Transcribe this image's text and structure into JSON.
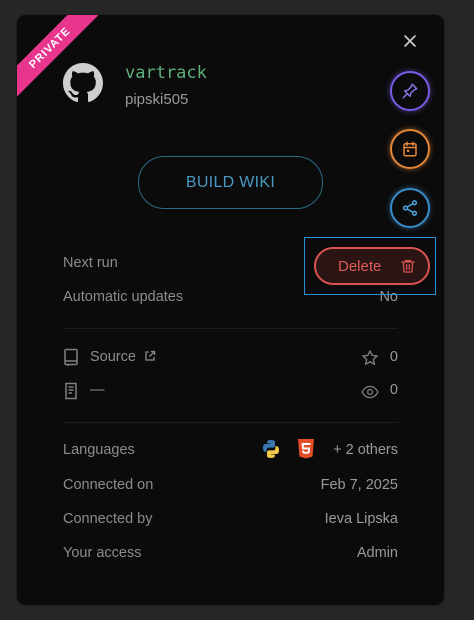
{
  "badge": "PRIVATE",
  "repo": {
    "name": "vartrack",
    "owner": "pipski505"
  },
  "build_button": "BUILD WIKI",
  "actions": {
    "pin": "pin-icon",
    "schedule": "calendar-icon",
    "share": "share-icon"
  },
  "delete_button": "Delete",
  "schedule": {
    "next_run_label": "Next run",
    "auto_updates_label": "Automatic updates",
    "auto_updates_value": "No"
  },
  "meta": {
    "source_label": "Source",
    "stars": "0",
    "description": "—",
    "watchers": "0"
  },
  "details": {
    "languages_label": "Languages",
    "languages_more": "+ 2 others",
    "connected_on_label": "Connected on",
    "connected_on_value": "Feb 7, 2025",
    "connected_by_label": "Connected by",
    "connected_by_value": "Ieva Lipska",
    "access_label": "Your access",
    "access_value": "Admin"
  },
  "colors": {
    "accent_green": "#5fb07a",
    "build_blue": "#4a99c2",
    "delete_red": "#d9534f",
    "badge_pink": "#e8368f"
  }
}
